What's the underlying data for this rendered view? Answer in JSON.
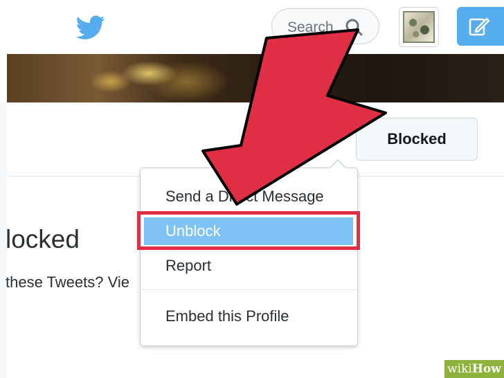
{
  "topbar": {
    "logo_icon": "twitter-bird-icon",
    "search": {
      "placeholder": "Search",
      "icon": "search-icon"
    },
    "compose_icon": "compose-tweet-icon",
    "colors": {
      "brand": "#55acee"
    }
  },
  "profile": {
    "blocked_button_label": "Blocked",
    "heading": "locked",
    "subtext": "these Tweets? Vie"
  },
  "dropdown": {
    "items": [
      {
        "label": "Send a Direct Message"
      },
      {
        "label": "Unblock"
      },
      {
        "label": "Report"
      },
      {
        "label": "Embed this Profile"
      }
    ],
    "selected_bg": "#7fc3f4"
  },
  "annotation": {
    "arrow_color": "#e02f44",
    "watermark_prefix": "wiki",
    "watermark_suffix": "How"
  }
}
